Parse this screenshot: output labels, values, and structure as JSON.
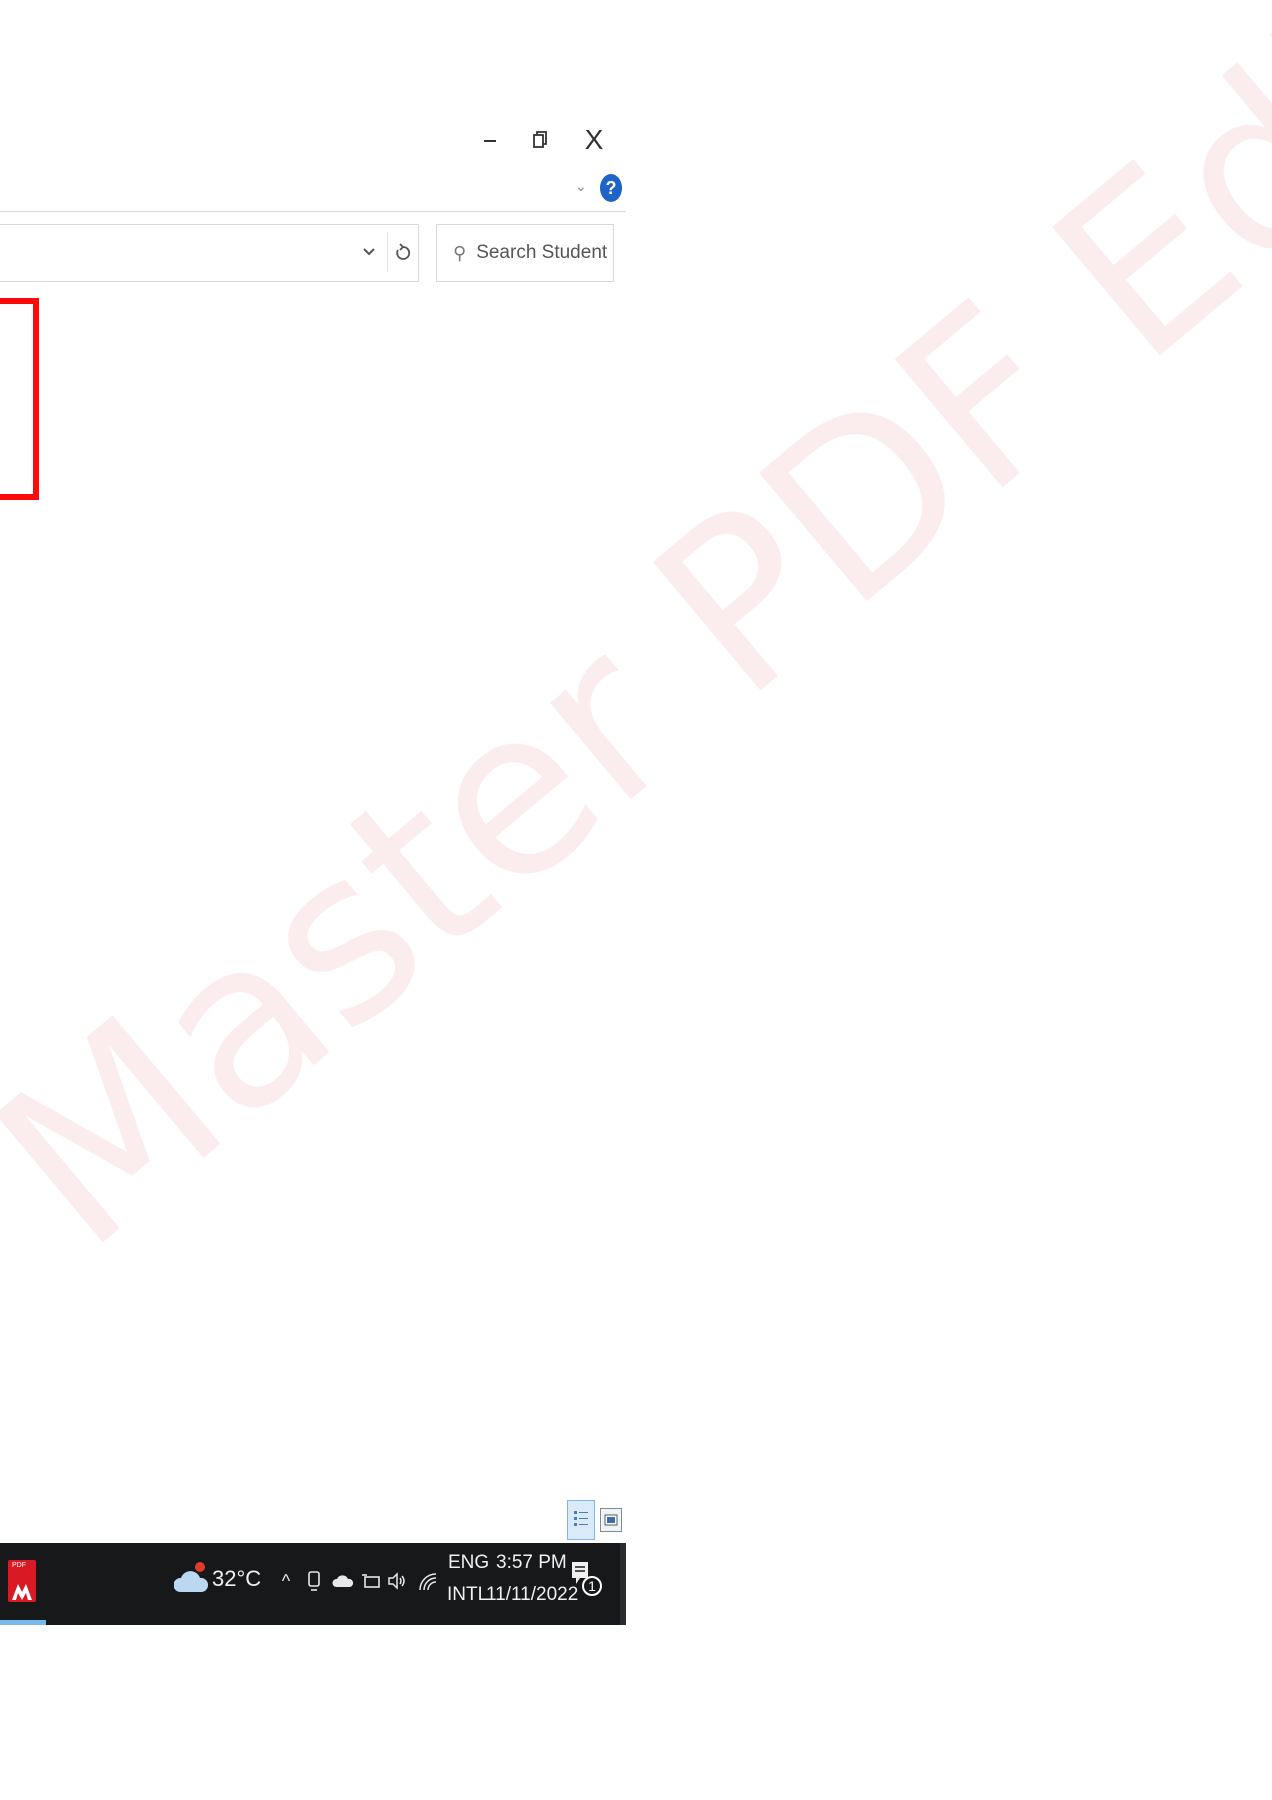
{
  "watermark": {
    "text": "Master PDF Editor"
  },
  "window": {
    "controls": {
      "minimize_icon": "minimize-icon",
      "maximize_icon": "restore-icon",
      "close_label": "X"
    },
    "ribbon": {
      "expand_icon": "chevron-down-icon",
      "help_label": "?"
    }
  },
  "address_bar": {
    "dropdown_icon": "chevron-down-icon",
    "refresh_icon": "refresh-icon"
  },
  "search": {
    "placeholder": "Search Student Inf..."
  },
  "status_bar": {
    "view_details_icon": "details-view-icon",
    "view_large_icon": "large-icons-view-icon"
  },
  "taskbar": {
    "app_icon_label": "PDF",
    "weather": {
      "temperature": "32°C",
      "icon": "cloud-icon"
    },
    "tray": {
      "show_hidden_label": "^",
      "icons": [
        "meet-now-icon",
        "onedrive-icon",
        "power-icon",
        "volume-icon",
        "wifi-icon"
      ]
    },
    "language": {
      "top": "ENG",
      "bottom": "INTL"
    },
    "clock": {
      "time": "3:57 PM",
      "date": "11/11/2022"
    },
    "notifications": {
      "count": "1"
    }
  },
  "colors": {
    "highlight": "#ff0a0a",
    "taskbar_bg": "#17181a",
    "help_blue": "#1e64c8",
    "accent": "#76b9ed"
  }
}
